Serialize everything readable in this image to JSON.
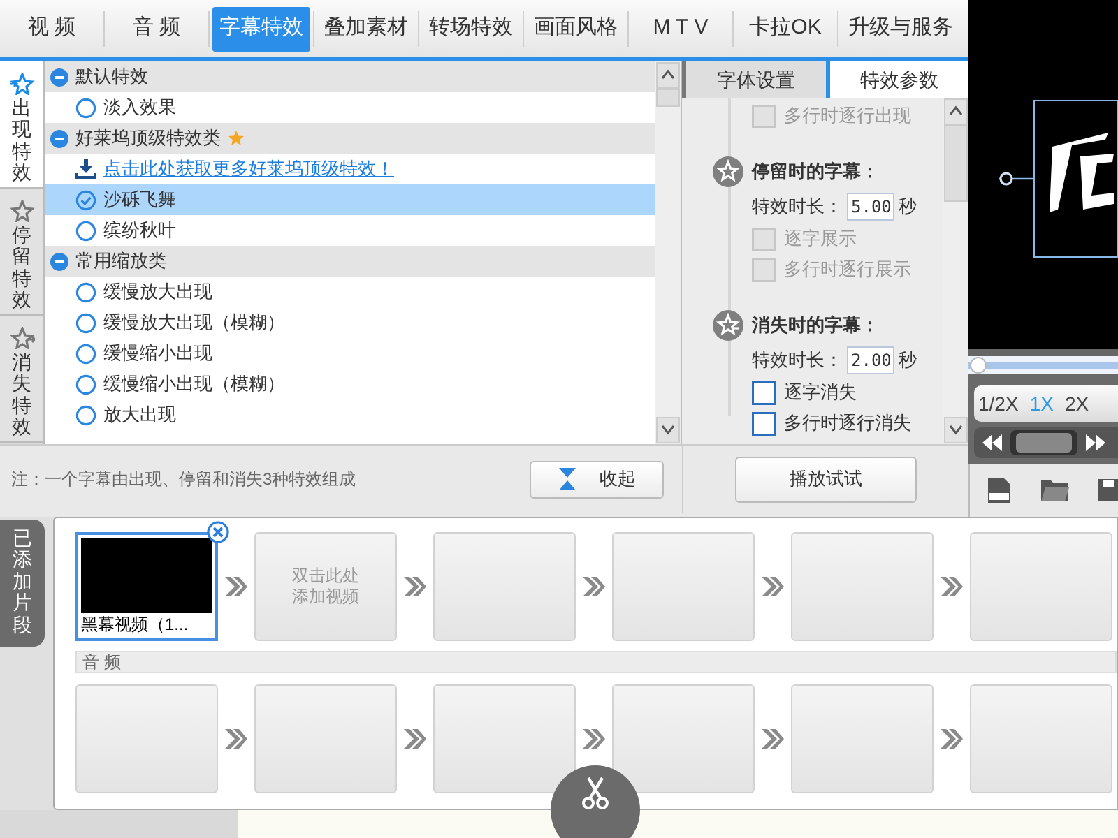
{
  "tabs": [
    {
      "label": "视 频",
      "selected": false
    },
    {
      "label": "音 频",
      "selected": false
    },
    {
      "label": "字幕特效",
      "selected": true
    },
    {
      "label": "叠加素材",
      "selected": false
    },
    {
      "label": "转场特效",
      "selected": false
    },
    {
      "label": "画面风格",
      "selected": false
    },
    {
      "label": "M T V",
      "selected": false
    },
    {
      "label": "卡拉OK",
      "selected": false
    },
    {
      "label": "升级与服务",
      "selected": false
    }
  ],
  "side_tabs": [
    {
      "label": "出现特效",
      "kind": "appear",
      "selected": true
    },
    {
      "label": "停留特效",
      "kind": "stay",
      "selected": false
    },
    {
      "label": "消失特效",
      "kind": "vanish",
      "selected": false
    }
  ],
  "effect_groups": [
    {
      "title": "默认特效",
      "expanded": true,
      "starred": false,
      "items": [
        {
          "kind": "radio",
          "label": "淡入效果",
          "selected": false
        }
      ]
    },
    {
      "title": "好莱坞顶级特效类",
      "expanded": true,
      "starred": true,
      "items": [
        {
          "kind": "link",
          "label": "点击此处获取更多好莱坞顶级特效！"
        },
        {
          "kind": "radio",
          "label": "沙砾飞舞",
          "selected": true
        },
        {
          "kind": "radio",
          "label": "缤纷秋叶",
          "selected": false
        }
      ]
    },
    {
      "title": "常用缩放类",
      "expanded": true,
      "starred": false,
      "items": [
        {
          "kind": "radio",
          "label": "缓慢放大出现",
          "selected": false
        },
        {
          "kind": "radio",
          "label": "缓慢放大出现（模糊）",
          "selected": false
        },
        {
          "kind": "radio",
          "label": "缓慢缩小出现",
          "selected": false
        },
        {
          "kind": "radio",
          "label": "缓慢缩小出现（模糊）",
          "selected": false
        },
        {
          "kind": "radio",
          "label": "放大出现",
          "selected": false
        }
      ]
    }
  ],
  "note": "注：一个字幕由出现、停留和消失3种特效组成",
  "collapse_button": "收起",
  "param_tabs": [
    {
      "label": "字体设置",
      "selected": false
    },
    {
      "label": "特效参数",
      "selected": true
    }
  ],
  "params": [
    {
      "kind": "checkbox",
      "label": "多行时逐行出现",
      "checked": false,
      "disabled": true
    },
    {
      "kind": "stay_heading",
      "label": "停留时的字幕："
    },
    {
      "kind": "duration",
      "label": "特效时长：",
      "value": "5.00",
      "unit": "秒"
    },
    {
      "kind": "checkbox",
      "label": "逐字展示",
      "checked": false,
      "disabled": true
    },
    {
      "kind": "checkbox",
      "label": "多行时逐行展示",
      "checked": false,
      "disabled": true
    },
    {
      "kind": "vanish_heading",
      "label": "消失时的字幕："
    },
    {
      "kind": "duration",
      "label": "特效时长：",
      "value": "2.00",
      "unit": "秒"
    },
    {
      "kind": "checkbox",
      "label": "逐字消失",
      "checked": false,
      "disabled": false
    },
    {
      "kind": "checkbox",
      "label": "多行时逐行消失",
      "checked": false,
      "disabled": false
    }
  ],
  "play_button": "播放试试",
  "preview": {
    "kind": "picture",
    "level": 0,
    "speeds": [
      {
        "label": "1/2X",
        "selected": false
      },
      {
        "label": "1X",
        "selected": true
      },
      {
        "label": "2X",
        "selected": false
      }
    ]
  },
  "timeline": {
    "label": "已添加片段",
    "video_slots": [
      {
        "kind": "clip",
        "label": "黑幕视频（1..."
      },
      {
        "kind": "hint",
        "lines": [
          "双击此处",
          "添加视频"
        ]
      },
      {
        "kind": "empty"
      },
      {
        "kind": "empty"
      },
      {
        "kind": "empty"
      },
      {
        "kind": "empty"
      }
    ],
    "audio_label": "音 频",
    "audio_slots": [
      {
        "kind": "empty"
      },
      {
        "kind": "empty"
      },
      {
        "kind": "empty"
      },
      {
        "kind": "empty"
      },
      {
        "kind": "empty"
      },
      {
        "kind": "empty"
      }
    ]
  }
}
